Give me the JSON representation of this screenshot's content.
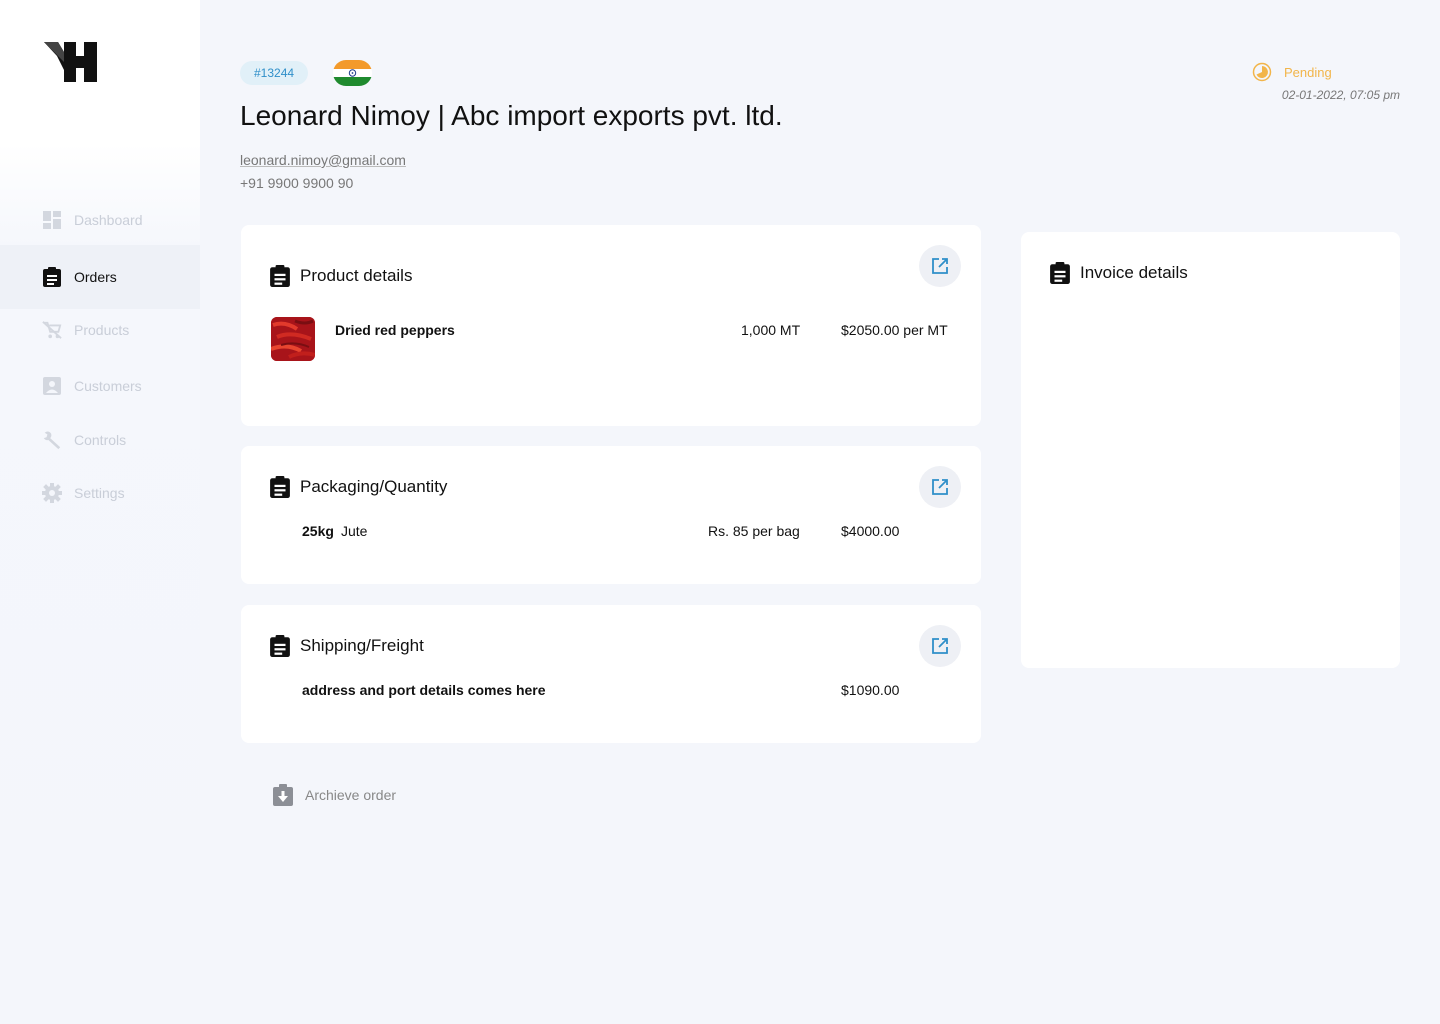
{
  "sidebar": {
    "logo_icon": "brand-logo-icon",
    "items": [
      {
        "label": "Dashboard",
        "icon": "dashboard-icon"
      },
      {
        "label": "Orders",
        "icon": "clipboard-icon",
        "active": true
      },
      {
        "label": "Products",
        "icon": "cart-off-icon"
      },
      {
        "label": "Customers",
        "icon": "contact-icon"
      },
      {
        "label": "Controls",
        "icon": "wrench-icon"
      },
      {
        "label": "Settings",
        "icon": "gear-icon"
      }
    ]
  },
  "header": {
    "order_id": "#13244",
    "flag": "india-flag-icon",
    "title": "Leonard Nimoy | Abc import exports pvt. ltd.",
    "email": "leonard.nimoy@gmail.com",
    "phone": "+91 9900 9900 90",
    "status": "Pending",
    "timestamp": "02-01-2022, 07:05 pm"
  },
  "product_details": {
    "title": "Product details",
    "product_name": "Dried red peppers",
    "quantity": "1,000 MT",
    "price": "$2050.00 per MT"
  },
  "packaging": {
    "title": "Packaging/Quantity",
    "size": "25kg",
    "material": "Jute",
    "rate": "Rs. 85 per bag",
    "total": "$4000.00"
  },
  "shipping": {
    "title": "Shipping/Freight",
    "address": "address and port details comes here",
    "total": "$1090.00"
  },
  "invoice": {
    "title": "Invoice details"
  },
  "archive": {
    "label": "Archieve order"
  },
  "colors": {
    "accent": "#2f8fc9",
    "pending": "#f2b54a",
    "background": "#f4f6fb"
  }
}
